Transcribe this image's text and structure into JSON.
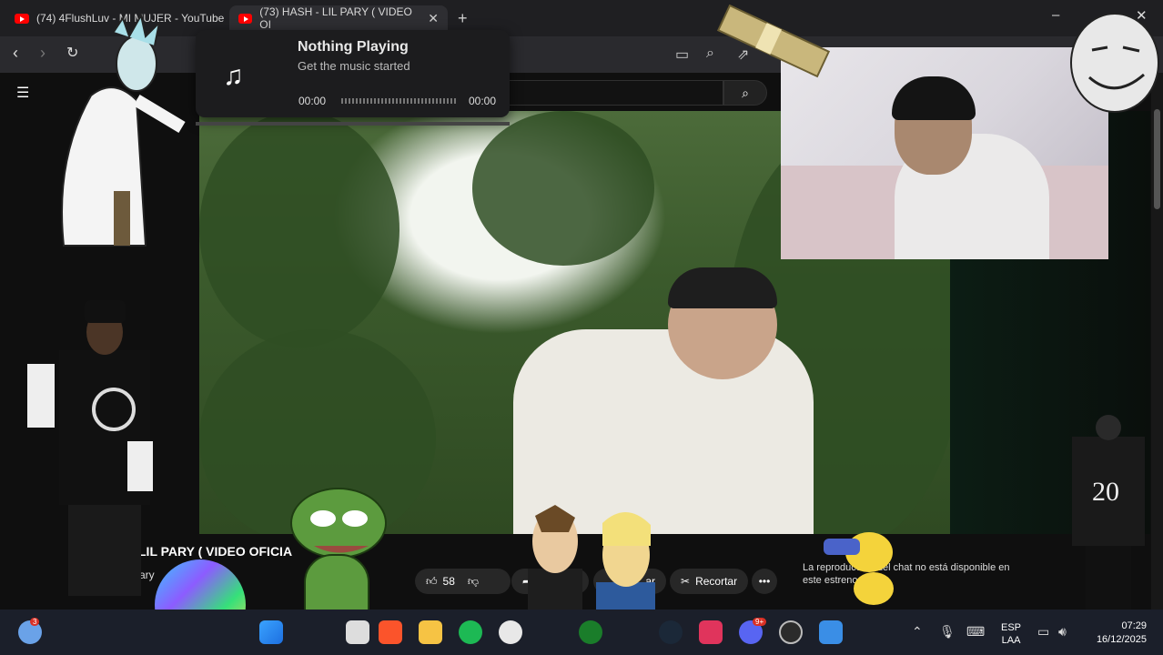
{
  "browser": {
    "tabs": [
      {
        "label": "(74) 4FlushLuv - MI MUJER - YouTube",
        "active": false
      },
      {
        "label": "(73) HASH - LIL PARY ( VIDEO OI",
        "active": true
      }
    ],
    "new_tab": "+",
    "minimize": "–",
    "close": "✕"
  },
  "music_widget": {
    "title": "Nothing Playing",
    "subtitle": "Get the music started",
    "time_start": "00:00",
    "time_end": "00:00"
  },
  "video": {
    "title": "LIL PARY ( VIDEO OFICIA",
    "channel": "Pary",
    "like_count": "58",
    "clip_label": "Recortar",
    "share_partial": "rtir",
    "save_partial": "ar",
    "chat_notice": "La reproducción del chat no está disponible en este estreno."
  },
  "taskbar": {
    "language": "ESP",
    "layout": "LAA",
    "time": "07:29",
    "date": "16/12/2025",
    "weather_badge": "3",
    "discord_badge": "9+"
  },
  "colors": {
    "youtube_red": "#ff0000",
    "background": "#0f0f0f",
    "taskbar": "#1b1f2a"
  }
}
